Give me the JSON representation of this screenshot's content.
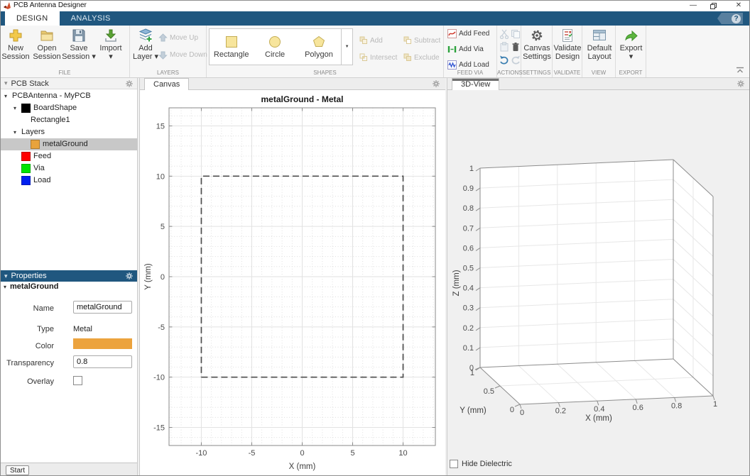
{
  "titlebar": {
    "title": "PCB Antenna Designer"
  },
  "ribbon_tabs": {
    "design": "DESIGN",
    "analysis": "ANALYSIS",
    "help": "?"
  },
  "toolstrip": {
    "file": {
      "label": "FILE",
      "new_session": "New\nSession",
      "open_session": "Open\nSession",
      "save_session": "Save\nSession ▾",
      "import": "Import\n▾"
    },
    "layers": {
      "label": "LAYERS",
      "add_layer": "Add\nLayer ▾",
      "move_up": "Move Up",
      "move_down": "Move Down"
    },
    "shapes": {
      "label": "SHAPES",
      "rectangle": "Rectangle",
      "circle": "Circle",
      "polygon": "Polygon",
      "add": "Add",
      "subtract": "Subtract",
      "intersect": "Intersect",
      "exclude": "Exclude"
    },
    "feed_via": {
      "label": "FEED VIA",
      "add_feed": "Add Feed",
      "add_via": "Add Via",
      "add_load": "Add Load"
    },
    "actions": {
      "label": "ACTIONS"
    },
    "settings": {
      "label": "SETTINGS",
      "canvas_settings": "Canvas\nSettings"
    },
    "validate": {
      "label": "VALIDATE",
      "validate_design": "Validate\nDesign"
    },
    "view": {
      "label": "VIEW",
      "default_layout": "Default\nLayout"
    },
    "export": {
      "label": "EXPORT",
      "export": "Export\n▾"
    }
  },
  "pcb_stack": {
    "title": "PCB Stack",
    "tree": [
      {
        "label": "PCBAntenna - MyPCB",
        "indent": 0,
        "expander": true
      },
      {
        "label": "BoardShape",
        "indent": 1,
        "expander": true,
        "swatch": "#000000"
      },
      {
        "label": "Rectangle1",
        "indent": 2
      },
      {
        "label": "Layers",
        "indent": 1,
        "expander": true
      },
      {
        "label": "metalGround",
        "indent": 2,
        "swatch": "#E8A33C",
        "selected": true
      },
      {
        "label": "Feed",
        "indent": 1,
        "swatch": "#FF0000"
      },
      {
        "label": "Via",
        "indent": 1,
        "swatch": "#00E400"
      },
      {
        "label": "Load",
        "indent": 1,
        "swatch": "#0020F0"
      }
    ]
  },
  "properties": {
    "title": "Properties",
    "group": "metalGround",
    "name_label": "Name",
    "name_value": "metalGround",
    "type_label": "Type",
    "type_value": "Metal",
    "color_label": "Color",
    "color_value": "#ECA33E",
    "transparency_label": "Transparency",
    "transparency_value": "0.8",
    "overlay_label": "Overlay",
    "overlay_checked": false
  },
  "status": {
    "start": "Start"
  },
  "canvas_panel": {
    "tab": "Canvas"
  },
  "view3d_panel": {
    "tab": "3D-View",
    "hide_dielectric": "Hide Dielectric",
    "hide_dielectric_checked": false
  },
  "chart_data": [
    {
      "type": "line",
      "title": "metalGround - Metal",
      "xlabel": "X (mm)",
      "ylabel": "Y (mm)",
      "xlim": [
        -13.2,
        13.2
      ],
      "ylim": [
        -16.8,
        16.8
      ],
      "xticks": [
        -10,
        -5,
        0,
        5,
        10
      ],
      "yticks": [
        -15,
        -10,
        -5,
        0,
        5,
        10,
        15
      ],
      "minor_step": 1,
      "grid": true,
      "series": [
        {
          "name": "metalGround boundary",
          "style": "dashed",
          "color": "#4d4d4d",
          "x": [
            -10,
            10,
            10,
            -10,
            -10
          ],
          "y": [
            -10,
            -10,
            10,
            10,
            -10
          ]
        }
      ]
    },
    {
      "type": "scatter",
      "subtype": "3d-axes-box",
      "xlabel": "X (mm)",
      "ylabel": "Y (mm)",
      "zlabel": "Z (mm)",
      "xlim": [
        0,
        1
      ],
      "ylim": [
        0,
        1
      ],
      "zlim": [
        0,
        1
      ],
      "xticks": [
        0,
        0.2,
        0.4,
        0.6,
        0.8,
        1
      ],
      "yticks": [
        0,
        0.5,
        1
      ],
      "zticks": [
        0,
        0.1,
        0.2,
        0.3,
        0.4,
        0.5,
        0.6,
        0.7,
        0.8,
        0.9,
        1
      ]
    }
  ]
}
